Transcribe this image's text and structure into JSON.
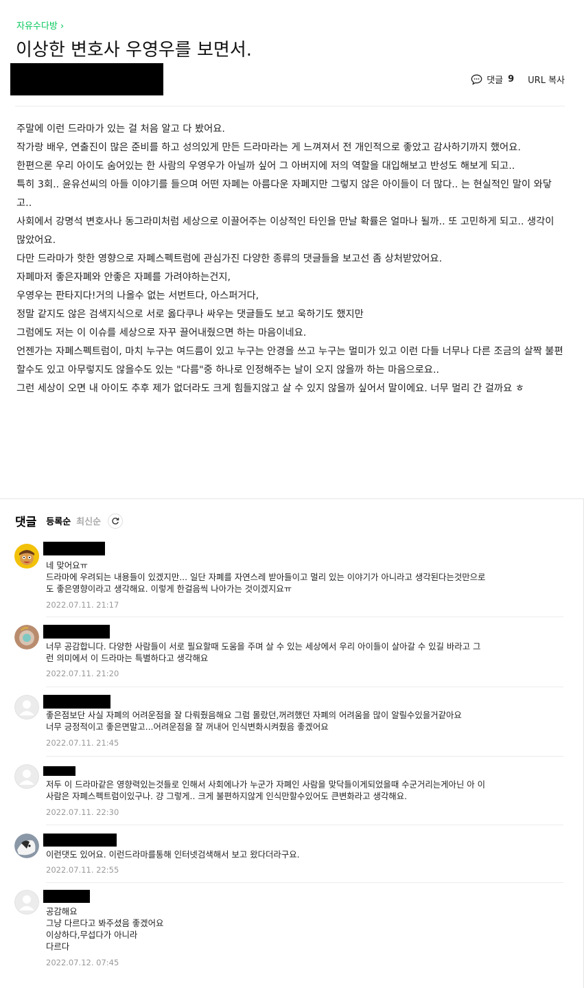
{
  "board": {
    "name": "자유수다방",
    "chevron": "›"
  },
  "post": {
    "title": "이상한 변호사 우영우를 보면서.",
    "comment_label": "댓글",
    "comment_count": "9",
    "url_copy_label": "URL 복사",
    "body": [
      "주말에 이런 드라마가 있는 걸 처음 알고 다 봤어요.",
      "작가랑 배우, 연출진이 많은 준비를 하고 성의있게 만든 드라마라는 게 느껴져서 전 개인적으로 좋았고 감사하기까지 했어요.",
      "한편으론 우리 아이도 숨어있는 한 사람의 우영우가 아닐까 싶어 그 아버지에 저의 역할을 대입해보고 반성도 해보게 되고..",
      "특히 3회.. 윤유선씨의 아들 이야기를 들으며 어떤 자폐는 아름다운 자폐지만 그렇지 않은 아이들이 더 많다.. 는 현실적인 말이 와닿고..",
      "사회에서 강명석 변호사나 동그라미처럼 세상으로 이끌어주는 이상적인 타인을 만날 확률은 얼마나 될까.. 또 고민하게 되고.. 생각이 많았어요.",
      "다만 드라마가 핫한 영향으로 자폐스펙트럼에 관심가진 다양한 종류의 댓글들을 보고선 좀 상처받았어요.",
      "자폐마저 좋은자폐와 안좋은 자폐를 가려야하는건지,",
      "우영우는 판타지다!거의 나올수 없는 서번트다, 아스퍼거다,",
      "정말 같지도 않은 검색지식으로 서로 옳다쿠나 싸우는 댓글들도 보고 욱하기도 했지만",
      "그럼에도 저는 이 이슈를 세상으로 자꾸 끌어내줬으면 하는 마음이네요.",
      "언젠가는 자폐스펙트럼이, 마치 누구는 여드름이 있고 누구는 안경을 쓰고 누구는 멀미가 있고 이런 다들 너무나 다른 조금의 살짝 불편할수도 있고 아무렇지도 않을수도 있는 \"다름\"중 하나로 인정해주는 날이 오지 않을까 하는 마음으로요..",
      "그런 세상이 오면 내 아이도 추후 제가 없더라도 크게 힘들지않고 살 수 있지 않을까 싶어서 말이에요. 너무 멀리 간 걸까요 ㅎ"
    ]
  },
  "comments_section": {
    "title": "댓글",
    "sort_options": [
      "등록순",
      "최신순"
    ],
    "active_sort": "등록순",
    "comments": [
      {
        "avatar": "cartoon-avatar",
        "lines": [
          "네 맞어요ㅠ",
          "드라마에 우려되는 내용들이 있겠지만... 일단 자폐를 자연스레 받아들이고 멀리 있는 이야기가 아니라고 생각된다는것만으로",
          "도 좋은영향이라고 생각해요. 이렇게 한걸음씩 나아가는 것이겠지요ㅠ"
        ],
        "date": "2022.07.11. 21:17"
      },
      {
        "avatar": "photo-avatar",
        "lines": [
          "너무 공감합니다. 다양한 사람들이 서로 필요할때 도움을 주며 살 수 있는 세상에서 우리 아이들이 살아갈 수 있길 바라고 그",
          "런 의미에서 이 드라마는 특별하다고 생각해요"
        ],
        "date": "2022.07.11. 21:20"
      },
      {
        "avatar": "default-avatar",
        "lines": [
          "좋은점보단 사실 자폐의 어려운점을 잘 다뤄줬음해요 그럼 몰랐던,꺼려했던 자폐의 어려움을 많이 알릴수있을거같아요",
          "너무 긍정적이고 좋은면말고...어려운점을 잘 꺼내어 인식변화시켜줬음 좋겠어요"
        ],
        "date": "2022.07.11. 21:45"
      },
      {
        "avatar": "default-avatar",
        "lines": [
          "저두 이 드라마같은 영향력있는것들로 인해서 사회에나가 누군가 자폐인 사람을 맞닥들이게되었을때 수군거리는게아닌 아 이",
          "사람은 자폐스펙트럼이있구나. 걍 그렇게.. 크게 불편하지않게 인식만할수있어도 큰변화라고 생각해요."
        ],
        "date": "2022.07.11. 22:30"
      },
      {
        "avatar": "dog-avatar",
        "lines": [
          "이런댓도 있어요. 이런드라마를통해 인터넷검색해서 보고 왔다더라구요."
        ],
        "date": "2022.07.11. 22:55"
      },
      {
        "avatar": "default-avatar",
        "lines": [
          "공감해요",
          "그냥 다르다고 봐주셨음 좋겠어요",
          "이상하다,무섭다가 아니라",
          "다르다"
        ],
        "date": "2022.07.12. 07:45"
      }
    ]
  },
  "colors": {
    "accent": "#03c75a",
    "date": "#999999",
    "muted_sort": "#aaaaaa"
  }
}
